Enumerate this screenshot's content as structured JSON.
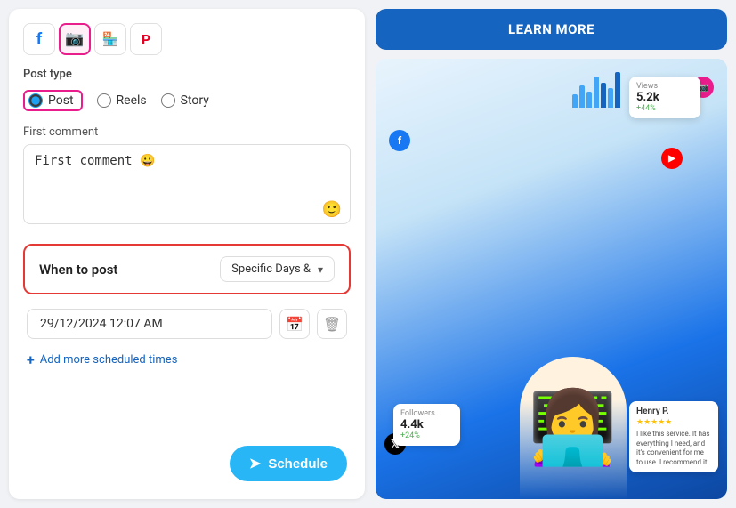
{
  "social_tabs": [
    {
      "id": "facebook",
      "icon": "f",
      "color": "#1877f2",
      "active": false
    },
    {
      "id": "instagram",
      "icon": "📷",
      "color": "#e91e8c",
      "active": true
    },
    {
      "id": "shop",
      "icon": "🏪",
      "color": "#555",
      "active": false
    },
    {
      "id": "pinterest",
      "icon": "P",
      "color": "#e60023",
      "active": false
    }
  ],
  "post_type": {
    "label": "Post type",
    "options": [
      "Post",
      "Reels",
      "Story"
    ],
    "selected": "Post"
  },
  "first_comment": {
    "label": "First comment",
    "placeholder": "First comment 😀",
    "value": "First comment 😀"
  },
  "when_to_post": {
    "label": "When to post",
    "dropdown_value": "Specific Days &",
    "dropdown_full": "Specific Days & Times"
  },
  "scheduled_time": {
    "value": "29/12/2024 12:07 AM"
  },
  "add_more": {
    "label": "Add more scheduled times",
    "icon": "+"
  },
  "schedule_button": {
    "label": "Schedule",
    "icon": "➤"
  },
  "learn_more": {
    "label": "LEARN MORE"
  },
  "promo": {
    "views_label": "Views",
    "views_value": "5.2k",
    "views_trend": "+44%",
    "followers_label": "Followers",
    "followers_value": "4.4k",
    "followers_trend": "+24%",
    "reviewer_name": "Henry P.",
    "review_text": "I like this service. It has everything I need, and it's convenient for me to use. I recommend it",
    "stars": "★★★★★"
  }
}
